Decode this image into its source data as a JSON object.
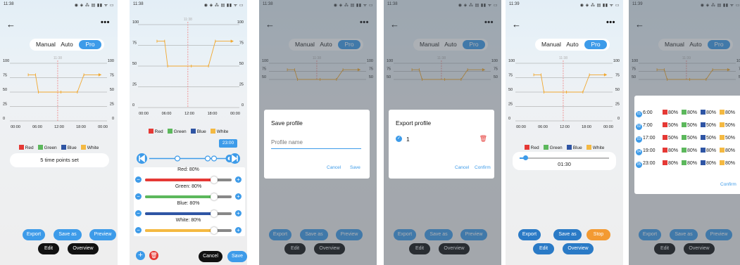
{
  "colors": {
    "accent": "#3d9be9",
    "red": "#e53935",
    "green": "#5cb85c",
    "blue": "#2f55a4",
    "white_channel": "#f4b942",
    "series_line": "#f0a830",
    "now_line": "#f08080"
  },
  "status": {
    "time_1": "11:38",
    "time_2": "11:38",
    "time_3": "11:38",
    "time_4": "11:38",
    "time_5": "11:39",
    "time_6": "11:39",
    "icons": "◉ ◈ ⁂ ▤ ▮▮ ᯤ ▭"
  },
  "header": {
    "back_icon": "arrow-left-icon",
    "more_icon": "more-icon",
    "back_glyph": "←",
    "more_glyph": "•••"
  },
  "modes": {
    "manual": "Manual",
    "auto": "Auto",
    "pro": "Pro"
  },
  "chart_data": {
    "type": "line",
    "x_ticks": [
      "00:00",
      "06:00",
      "12:00",
      "18:00",
      "00:00"
    ],
    "y_ticks": [
      "0",
      "25",
      "50",
      "75",
      "100"
    ],
    "ylim": [
      0,
      100
    ],
    "xlim": [
      0,
      24
    ],
    "now_time": 11.6,
    "now_label_1": "11:38",
    "now_label_2": "11:38",
    "now_label_3": "11:38",
    "now_label_4": "11:39",
    "points": [
      [
        3.5,
        80
      ],
      [
        5.5,
        80
      ],
      [
        6.3,
        50
      ],
      [
        12.5,
        50
      ],
      [
        17.0,
        50
      ],
      [
        18.8,
        80
      ],
      [
        22.9,
        80
      ]
    ],
    "legend": [
      "Red",
      "Green",
      "Blue",
      "White"
    ]
  },
  "summary": {
    "text": "5 time points set"
  },
  "buttons": {
    "export": "Export",
    "save_as": "Save as",
    "preview": "Preview",
    "edit": "Edit",
    "overview": "Overview",
    "stop": "Stop",
    "cancel": "Cancel",
    "save": "Save",
    "confirm": "Confirm"
  },
  "editor": {
    "time_bubble": "23:00",
    "sliders": [
      {
        "label": "Red: 80%",
        "value": 80
      },
      {
        "label": "Green: 80%",
        "value": 80
      },
      {
        "label": "Blue: 80%",
        "value": 80
      },
      {
        "label": "White: 80%",
        "value": 80
      }
    ]
  },
  "save_dialog": {
    "title": "Save profile",
    "placeholder": "Profile name",
    "cancel": "Cancel",
    "save": "Save"
  },
  "export_dialog": {
    "title": "Export profile",
    "item": "1",
    "cancel": "Cancel",
    "confirm": "Confirm"
  },
  "preview_panel": {
    "time": "01:30",
    "progress": 0.07
  },
  "overview_table": {
    "rows": [
      {
        "num": "01",
        "time": "6:00",
        "red": "80%",
        "green": "80%",
        "blue": "80%",
        "white": "80%"
      },
      {
        "num": "02",
        "time": "7:00",
        "red": "50%",
        "green": "50%",
        "blue": "50%",
        "white": "50%"
      },
      {
        "num": "03",
        "time": "17:00",
        "red": "50%",
        "green": "50%",
        "blue": "50%",
        "white": "50%"
      },
      {
        "num": "04",
        "time": "19:00",
        "red": "80%",
        "green": "80%",
        "blue": "80%",
        "white": "80%"
      },
      {
        "num": "05",
        "time": "23:00",
        "red": "80%",
        "green": "80%",
        "blue": "80%",
        "white": "80%"
      }
    ],
    "confirm": "Confirm"
  }
}
